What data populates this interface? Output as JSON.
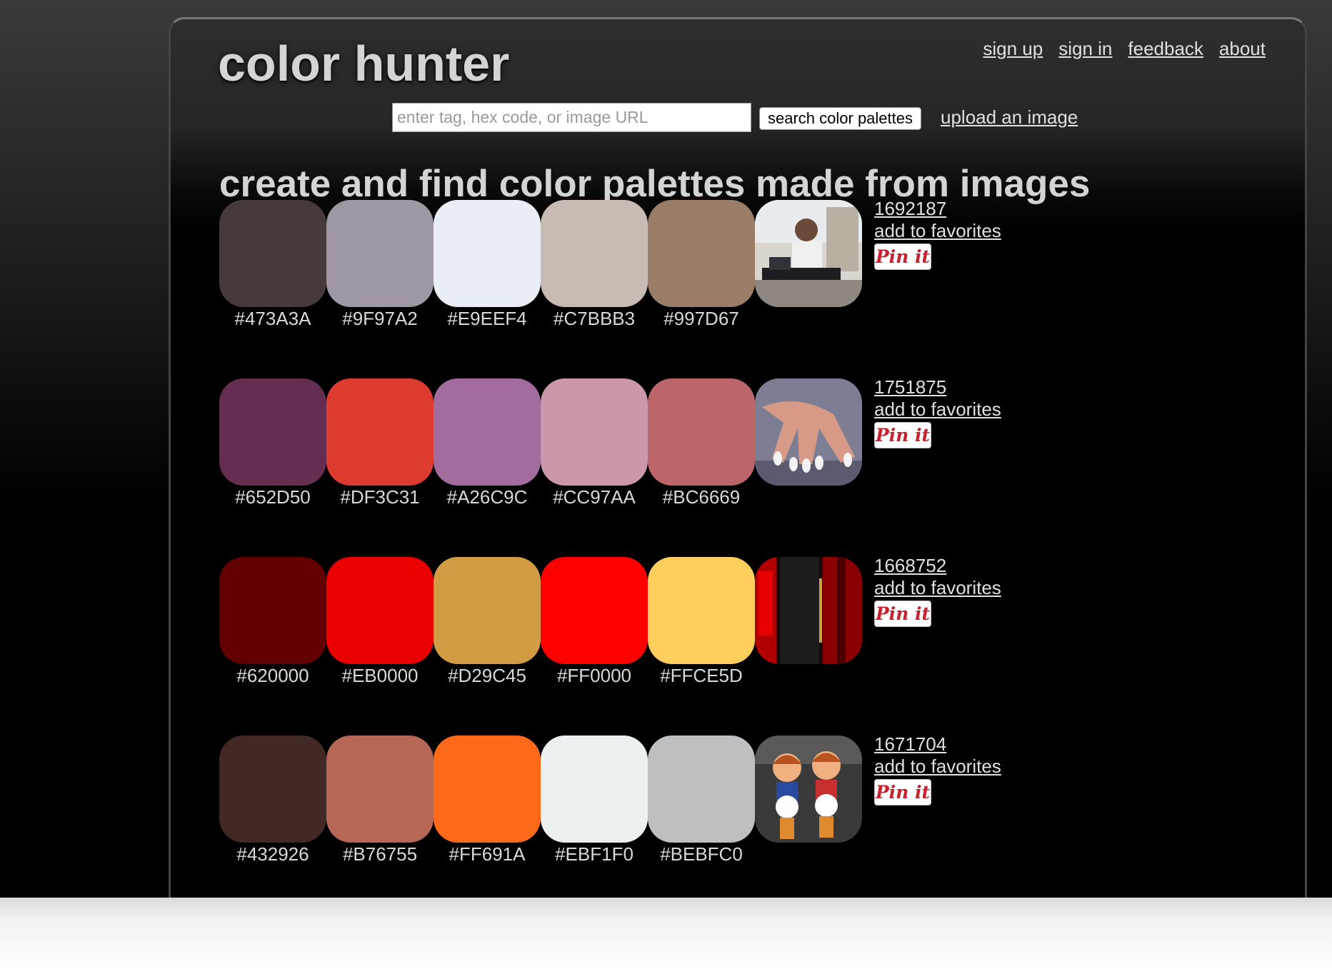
{
  "site": {
    "logo": "color hunter",
    "nav": [
      "sign up",
      "sign in",
      "feedback",
      "about"
    ],
    "search_placeholder": "enter tag, hex code, or image URL",
    "search_button": "search color palettes",
    "upload_link": "upload an image",
    "headline": "create and find color palettes made from images"
  },
  "palettes": [
    {
      "id": "1692187",
      "favorite_label": "add to favorites",
      "pin_label": "Pin it",
      "thumbnail_icon": "musician-photo",
      "colors": [
        {
          "hex": "#473A3A",
          "label": "#473A3A"
        },
        {
          "hex": "#9F97A2",
          "label": "#9F97A2"
        },
        {
          "hex": "#E9EEF4",
          "label": "#E9EEF4"
        },
        {
          "hex": "#C7BBB3",
          "label": "#C7BBB3"
        },
        {
          "hex": "#997D67",
          "label": "#997D67"
        }
      ]
    },
    {
      "id": "1751875",
      "favorite_label": "add to favorites",
      "pin_label": "Pin it",
      "thumbnail_icon": "painted-nails-photo",
      "colors": [
        {
          "hex": "#652D50",
          "label": "#652D50"
        },
        {
          "hex": "#DF3C31",
          "label": "#DF3C31"
        },
        {
          "hex": "#A26C9C",
          "label": "#A26C9C"
        },
        {
          "hex": "#CC97AA",
          "label": "#CC97AA"
        },
        {
          "hex": "#BC6669",
          "label": "#BC6669"
        }
      ]
    },
    {
      "id": "1668752",
      "favorite_label": "add to favorites",
      "pin_label": "Pin it",
      "thumbnail_icon": "red-curtain-photo",
      "colors": [
        {
          "hex": "#620000",
          "label": "#620000"
        },
        {
          "hex": "#EB0000",
          "label": "#EB0000"
        },
        {
          "hex": "#D29C45",
          "label": "#D29C45"
        },
        {
          "hex": "#FF0000",
          "label": "#FF0000"
        },
        {
          "hex": "#FFCE5D",
          "label": "#FFCE5D"
        }
      ]
    },
    {
      "id": "1671704",
      "favorite_label": "add to favorites",
      "pin_label": "Pin it",
      "thumbnail_icon": "toy-figures-photo",
      "colors": [
        {
          "hex": "#432926",
          "label": "#432926"
        },
        {
          "hex": "#B76755",
          "label": "#B76755"
        },
        {
          "hex": "#FF691A",
          "label": "#FF691A"
        },
        {
          "hex": "#EBF1F0",
          "label": "#EBF1F0"
        },
        {
          "hex": "#BEBFC0",
          "label": "#BEBFC0"
        }
      ]
    }
  ]
}
